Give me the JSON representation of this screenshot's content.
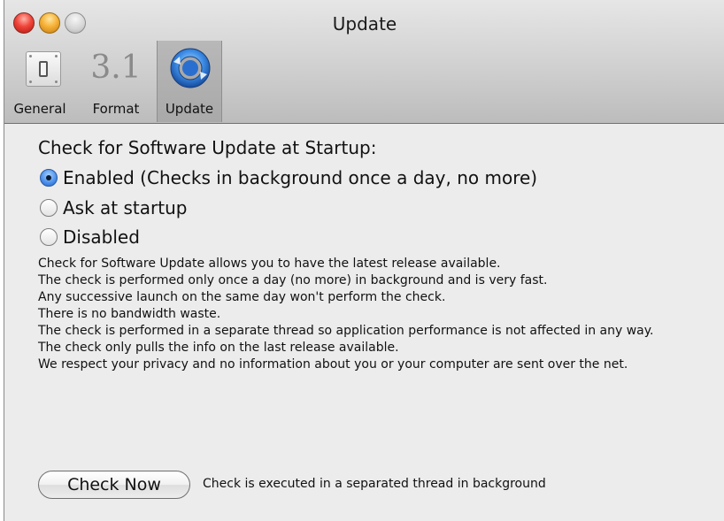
{
  "window": {
    "title": "Update"
  },
  "toolbar": {
    "items": [
      {
        "label": "General",
        "icon": "switch-icon"
      },
      {
        "label": "Format",
        "icon": "format-icon",
        "glyph": "3.1"
      },
      {
        "label": "Update",
        "icon": "update-icon",
        "selected": true
      }
    ]
  },
  "startup": {
    "heading": "Check for Software Update at Startup:",
    "options": [
      {
        "label": "Enabled (Checks in background once a day, no more)",
        "selected": true
      },
      {
        "label": "Ask at startup",
        "selected": false
      },
      {
        "label": "Disabled",
        "selected": false
      }
    ]
  },
  "description": [
    "Check for Software Update allows you to have the latest release available.",
    "The check is performed only once a day (no more) in background and is very fast.",
    "Any successive launch on the same day won't perform the check.",
    "There is no bandwidth waste.",
    "The check is performed in a separate thread so application performance is not affected in any way.",
    "The check only pulls the info on the last release available.",
    "We respect your privacy and no information about you or your computer are sent over the net."
  ],
  "check_now": {
    "button_label": "Check Now",
    "note": "Check is executed in a separated thread in background"
  },
  "colors": {
    "window_bg": "#ececec",
    "radio_selected": "#3f86e6",
    "close": "#f0453a",
    "minimize": "#f6b33a",
    "zoom": "#d4d4d4"
  }
}
